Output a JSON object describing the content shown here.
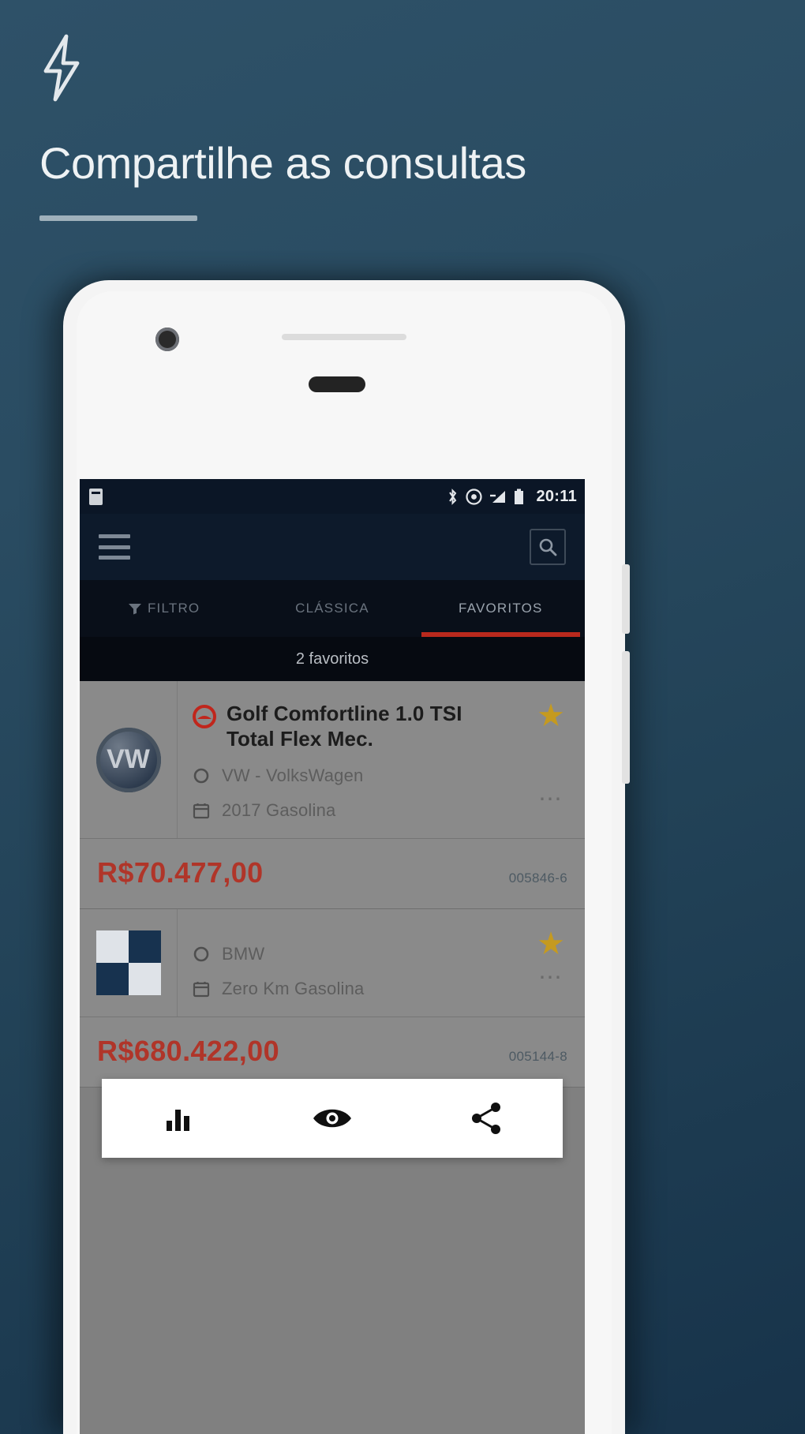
{
  "promo": {
    "icon": "lightning-bolt-icon",
    "title": "Compartilhe as consultas",
    "accent_color": "#9fb0bb",
    "background_colors": [
      "#2e5168",
      "#17334a"
    ]
  },
  "phone": {
    "status_bar": {
      "time": "20:11",
      "icons": [
        "bluetooth-icon",
        "do-not-disturb-icon",
        "signal-icon",
        "battery-icon"
      ],
      "left_icon": "sim-card-icon",
      "background": "#0b1626"
    },
    "app_bar": {
      "menu_icon": "hamburger-menu-icon",
      "search_icon": "search-icon",
      "background": "#0d1a2b"
    },
    "tabs": [
      {
        "label": "FILTRO",
        "icon": "filter-icon",
        "active": false
      },
      {
        "label": "CLÁSSICA",
        "icon": "",
        "active": false
      },
      {
        "label": "FAVORITOS",
        "icon": "",
        "active": true
      }
    ],
    "tab_indicator_color": "#b9291d",
    "favorites_count_label": "2 favoritos",
    "cards": [
      {
        "logo": "vw-logo",
        "logo_text": "VW",
        "brand_mark": "car-brand-icon",
        "title": "Golf Comfortline 1.0 TSI Total Flex Mec.",
        "brand_meta": "VW - VolksWagen",
        "brand_meta_icon": "circle-icon",
        "year_meta": "2017 Gasolina",
        "year_meta_icon": "calendar-icon",
        "favorite_icon": "star-filled-icon",
        "overflow_icon": "more-options-icon",
        "price": "R$70.477,00",
        "price_code": "005846-6"
      },
      {
        "logo": "bmw-logo",
        "logo_text": "",
        "brand_mark": "car-brand-icon",
        "title": "",
        "brand_meta": "BMW",
        "brand_meta_icon": "circle-icon",
        "year_meta": "Zero Km Gasolina",
        "year_meta_icon": "calendar-icon",
        "favorite_icon": "star-filled-icon",
        "overflow_icon": "more-options-icon",
        "price": "R$680.422,00",
        "price_code": "005144-8"
      }
    ],
    "action_sheet": {
      "buttons": [
        {
          "name": "chart-icon",
          "label": ""
        },
        {
          "name": "eye-icon",
          "label": ""
        },
        {
          "name": "share-icon",
          "label": ""
        }
      ],
      "background": "#ffffff"
    }
  }
}
